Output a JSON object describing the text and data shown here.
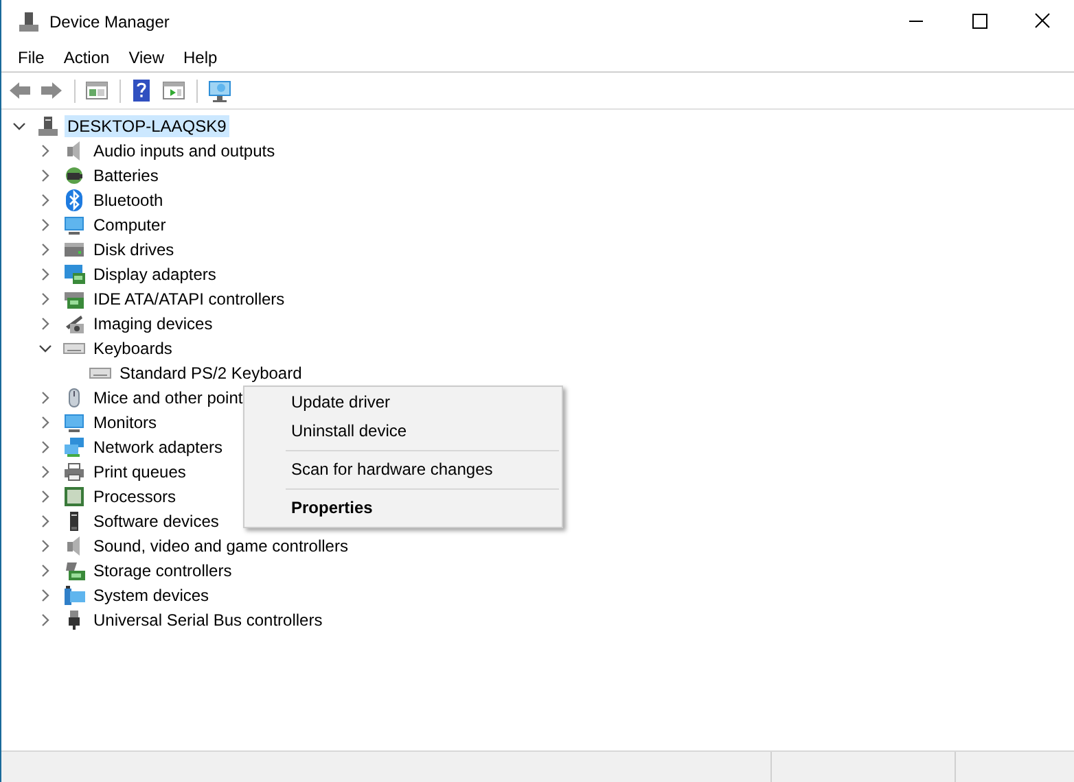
{
  "window": {
    "title": "Device Manager"
  },
  "menu_bar": [
    "File",
    "Action",
    "View",
    "Help"
  ],
  "toolbar": [
    {
      "kind": "back"
    },
    {
      "kind": "forward"
    },
    {
      "kind": "separator"
    },
    {
      "kind": "properties"
    },
    {
      "kind": "separator"
    },
    {
      "kind": "help"
    },
    {
      "kind": "update"
    },
    {
      "kind": "separator"
    },
    {
      "kind": "scan"
    }
  ],
  "tree": {
    "label": "DESKTOP-LAAQSK9",
    "kind": "computer-root",
    "expanded": true,
    "selected": true,
    "children": [
      {
        "label": "Audio inputs and outputs",
        "kind": "speaker",
        "expanded": false,
        "selected": false
      },
      {
        "label": "Batteries",
        "kind": "battery",
        "expanded": false,
        "selected": false
      },
      {
        "label": "Bluetooth",
        "kind": "bluetooth",
        "expanded": false,
        "selected": false
      },
      {
        "label": "Computer",
        "kind": "monitor",
        "expanded": false,
        "selected": false
      },
      {
        "label": "Disk drives",
        "kind": "disk",
        "expanded": false,
        "selected": false
      },
      {
        "label": "Display adapters",
        "kind": "display",
        "expanded": false,
        "selected": false
      },
      {
        "label": "IDE ATA/ATAPI controllers",
        "kind": "card",
        "expanded": false,
        "selected": false
      },
      {
        "label": "Imaging devices",
        "kind": "camera",
        "expanded": false,
        "selected": false
      },
      {
        "label": "Keyboards",
        "kind": "keyboard",
        "expanded": true,
        "selected": false,
        "children": [
          {
            "label": "Standard PS/2 Keyboard",
            "kind": "keyboard",
            "selected": false
          }
        ]
      },
      {
        "label": "Mice and other point",
        "kind": "mouse",
        "expanded": false,
        "selected": false
      },
      {
        "label": "Monitors",
        "kind": "monitor",
        "expanded": false,
        "selected": false
      },
      {
        "label": "Network adapters",
        "kind": "network",
        "expanded": false,
        "selected": false
      },
      {
        "label": "Print queues",
        "kind": "printer",
        "expanded": false,
        "selected": false
      },
      {
        "label": "Processors",
        "kind": "chip",
        "expanded": false,
        "selected": false
      },
      {
        "label": "Software devices",
        "kind": "tower",
        "expanded": false,
        "selected": false
      },
      {
        "label": "Sound, video and game controllers",
        "kind": "speaker",
        "expanded": false,
        "selected": false
      },
      {
        "label": "Storage controllers",
        "kind": "storage",
        "expanded": false,
        "selected": false
      },
      {
        "label": "System devices",
        "kind": "system",
        "expanded": false,
        "selected": false
      },
      {
        "label": "Universal Serial Bus controllers",
        "kind": "usb",
        "expanded": false,
        "selected": false
      }
    ]
  },
  "context_menu": [
    {
      "kind": "item",
      "label": "Update driver",
      "default": false
    },
    {
      "kind": "item",
      "label": "Uninstall device",
      "default": false
    },
    {
      "kind": "separator"
    },
    {
      "kind": "item",
      "label": "Scan for hardware changes",
      "default": false
    },
    {
      "kind": "separator"
    },
    {
      "kind": "item",
      "label": "Properties",
      "default": true
    }
  ]
}
